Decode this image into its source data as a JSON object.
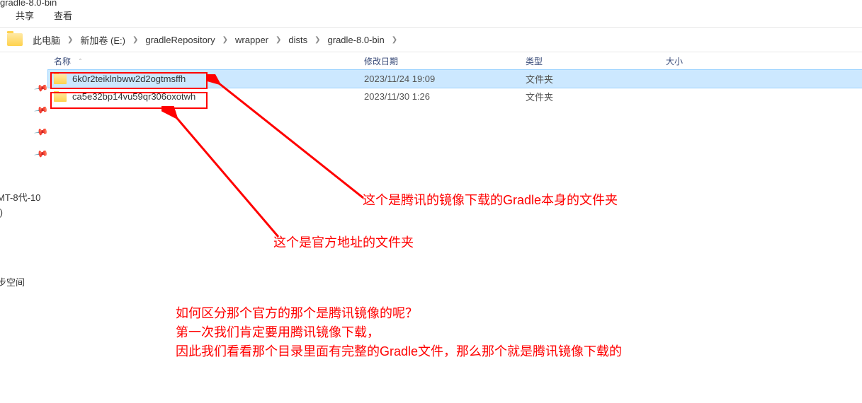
{
  "title_fragment": "gradle-8.0-bin",
  "menu": {
    "share": "共享",
    "view": "查看"
  },
  "breadcrumb": [
    {
      "label": "此电脑"
    },
    {
      "label": "新加卷 (E:)"
    },
    {
      "label": "gradleRepository"
    },
    {
      "label": "wrapper"
    },
    {
      "label": "dists"
    },
    {
      "label": "gradle-8.0-bin"
    }
  ],
  "columns": {
    "name": "名称",
    "date": "修改日期",
    "type": "类型",
    "size": "大小"
  },
  "rows": [
    {
      "name": "6k0r2teiklnbww2d2ogtmsffh",
      "date": "2023/11/24 19:09",
      "type": "文件夹",
      "selected": true
    },
    {
      "name": "ca5e32bp14vu59qr306oxotwh",
      "date": "2023/11/30 1:26",
      "type": "文件夹",
      "selected": false
    }
  ],
  "annotations": {
    "tencent_folder": "这个是腾讯的镜像下载的Gradle本身的文件夹",
    "official_folder": "这个是官方地址的文件夹",
    "explanation_l1": "如何区分那个官方的那个是腾讯镜像的呢？",
    "explanation_l2": "第一次我们肯定要用腾讯镜像下载，",
    "explanation_l3": "因此我们看看那个目录里面有完整的Gradle文件，那么那个就是腾讯镜像下载的"
  },
  "left": {
    "text1_l1": "MT-8代-10",
    "text1_l2": ":)",
    "text2": "步空间"
  },
  "colors": {
    "red": "#ff0000",
    "selected_bg": "#cce8ff"
  }
}
